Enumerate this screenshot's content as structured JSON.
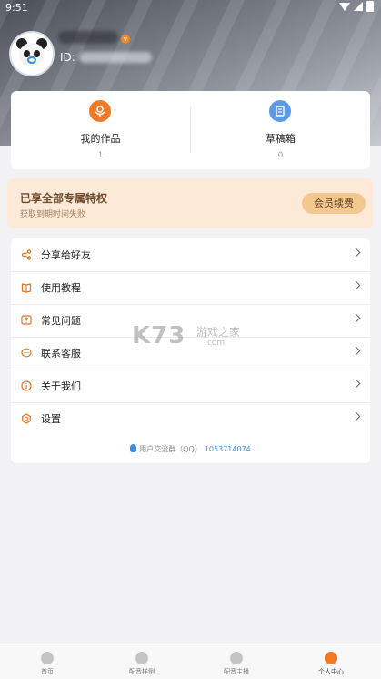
{
  "status_bar": {
    "time": "9:51"
  },
  "profile": {
    "id_label": "ID:",
    "vip_badge": "v"
  },
  "stats": [
    {
      "label": "我的作品",
      "count": "1",
      "icon": "works-icon"
    },
    {
      "label": "草稿箱",
      "count": "0",
      "icon": "drafts-icon"
    }
  ],
  "vip": {
    "title": "已享全部专属特权",
    "subtitle": "获取到期时间失败",
    "button": "会员续费"
  },
  "menu": [
    {
      "label": "分享给好友",
      "icon": "share-icon"
    },
    {
      "label": "使用教程",
      "icon": "tutorial-book-icon"
    },
    {
      "label": "常见问题",
      "icon": "question-icon"
    },
    {
      "label": "联系客服",
      "icon": "chat-icon"
    },
    {
      "label": "关于我们",
      "icon": "info-icon"
    },
    {
      "label": "设置",
      "icon": "settings-icon"
    }
  ],
  "qq_group": {
    "label": "用户交流群（QQ）",
    "number": "1053714074"
  },
  "watermark": {
    "main": "K73",
    "side": "游戏之家",
    "domain": ".com"
  },
  "tabs": [
    {
      "label": "首页",
      "active": false
    },
    {
      "label": "配音样例",
      "active": false
    },
    {
      "label": "配音主播",
      "active": false
    },
    {
      "label": "个人中心",
      "active": true
    }
  ],
  "colors": {
    "accent": "#f07a28",
    "vip_bg": "#fce9d7",
    "vip_button": "#f3c88f",
    "link": "#3a8fe0"
  }
}
